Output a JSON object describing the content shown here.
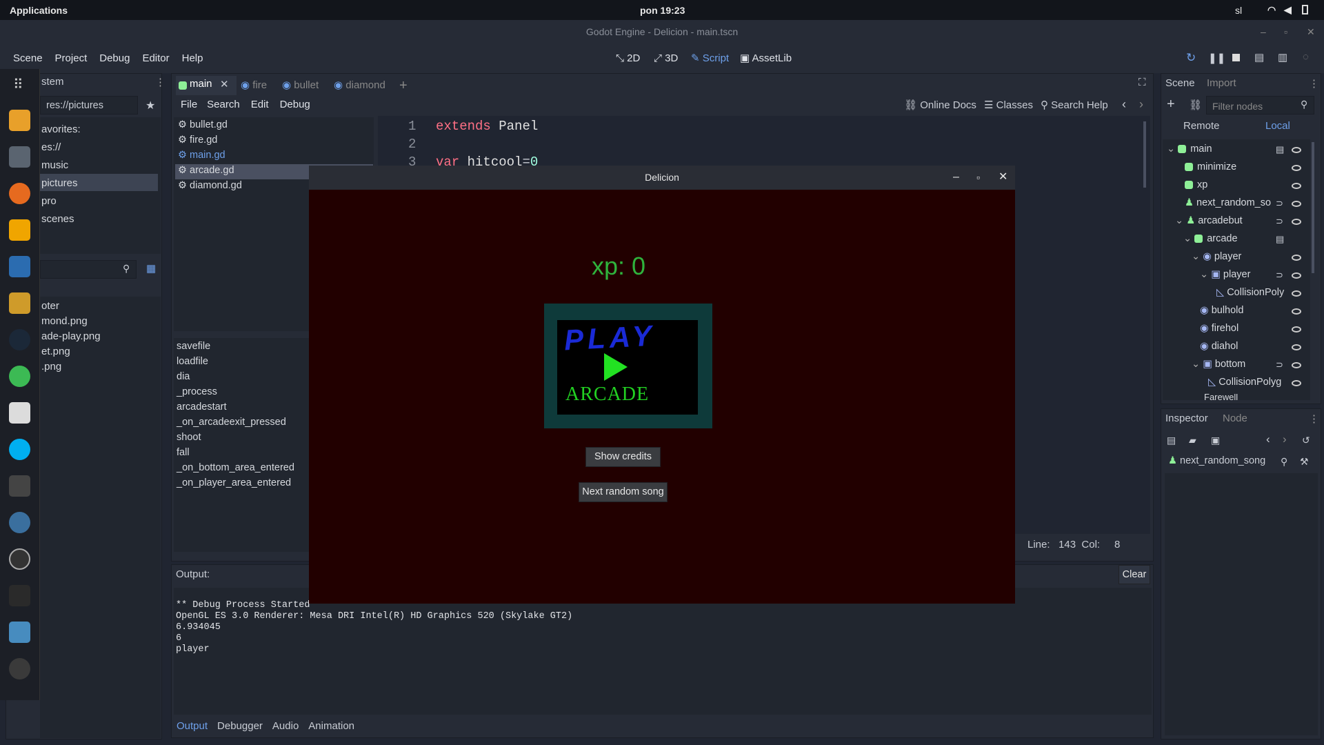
{
  "system": {
    "applications": "Applications",
    "clock": "pon 19:23",
    "lang": "sl"
  },
  "window_title": "Godot Engine - Delicion - main.tscn",
  "menu": [
    "Scene",
    "Project",
    "Debug",
    "Editor",
    "Help"
  ],
  "workspaces": {
    "w2d": "2D",
    "w3d": "3D",
    "script": "Script",
    "assetlib": "AssetLib"
  },
  "filesystem": {
    "tab": "stem",
    "path": "res://pictures",
    "favorites": "avorites:",
    "root": "es://",
    "folders": [
      "music",
      "pictures",
      "pro",
      "scenes"
    ],
    "files": [
      "oter",
      "mond.png",
      "ade-play.png",
      "et.png",
      ".png"
    ]
  },
  "script_tabs": [
    "main",
    "fire",
    "bullet",
    "diamond"
  ],
  "script_menu": [
    "File",
    "Search",
    "Edit",
    "Debug"
  ],
  "script_tools": {
    "docs": "Online Docs",
    "classes": "Classes",
    "help": "Search Help"
  },
  "scripts": [
    "bullet.gd",
    "fire.gd",
    "main.gd",
    "arcade.gd",
    "diamond.gd"
  ],
  "methods": [
    "savefile",
    "loadfile",
    "dia",
    "_process",
    "arcadestart",
    "_on_arcadeexit_pressed",
    "shoot",
    "fall",
    "_on_bottom_area_entered",
    "_on_player_area_entered"
  ],
  "code": {
    "l1": "1",
    "l2": "2",
    "l3": "3",
    "k1": "extends",
    "t1": "Panel",
    "k2": "var",
    "v3": "hitcool",
    "n3": "0"
  },
  "status": {
    "line_label": "Line:",
    "line": "143",
    "col_label": "Col:",
    "col": "8"
  },
  "output": {
    "label": "Output:",
    "clear": "Clear",
    "lines": [
      "** Debug Process Started **",
      "OpenGL ES 3.0 Renderer: Mesa DRI Intel(R) HD Graphics 520 (Skylake GT2)",
      "6.934045",
      "6",
      "player"
    ]
  },
  "bottom_tabs": [
    "Output",
    "Debugger",
    "Audio",
    "Animation"
  ],
  "scene_dock": {
    "tabs": [
      "Scene",
      "Import"
    ],
    "filter": "Filter nodes",
    "remote": "Remote",
    "local": "Local",
    "nodes": [
      "main",
      "minimize",
      "xp",
      "next_random_so",
      "arcadebut",
      "arcade",
      "player",
      "player",
      "CollisionPoly",
      "bulhold",
      "firehol",
      "diahol",
      "bottom",
      "CollisionPolyg",
      "Farewell"
    ]
  },
  "inspector": {
    "tabs": [
      "Inspector",
      "Node"
    ],
    "node": "next_random_song"
  },
  "game": {
    "title": "Delicion",
    "xp": "xp: 0",
    "play": "PLAY",
    "arcade": "ARCADE",
    "credits": "Show credits",
    "next_song": "Next random song"
  },
  "colors": {
    "accent": "#6ea0ea",
    "game_bg": "#220000",
    "xp_green": "#2fb33c"
  }
}
